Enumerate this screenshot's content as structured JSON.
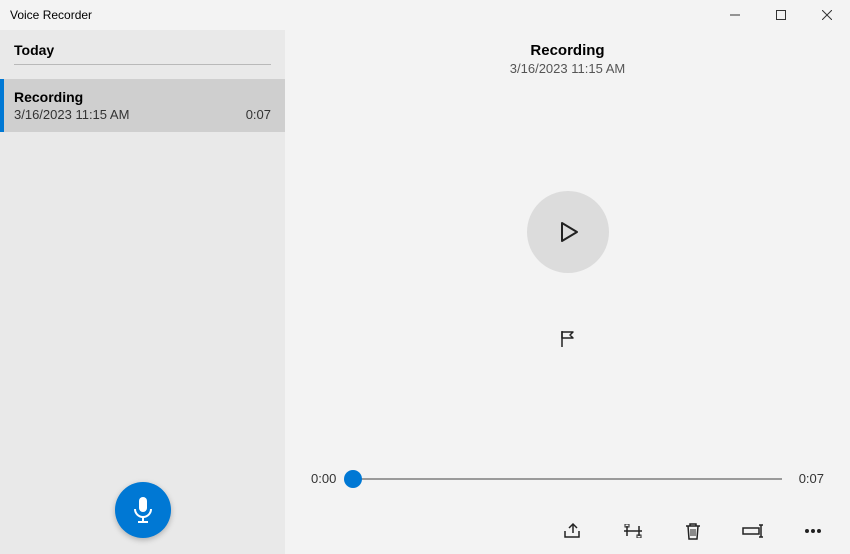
{
  "app": {
    "title": "Voice Recorder"
  },
  "sidebar": {
    "section_label": "Today",
    "items": [
      {
        "title": "Recording",
        "timestamp": "3/16/2023 11:15 AM",
        "duration": "0:07"
      }
    ]
  },
  "main": {
    "title": "Recording",
    "timestamp": "3/16/2023 11:15 AM",
    "playback": {
      "current": "0:00",
      "total": "0:07"
    }
  },
  "icons": {
    "minimize": "minimize-icon",
    "maximize": "maximize-icon",
    "close": "close-icon",
    "microphone": "microphone-icon",
    "play": "play-icon",
    "flag": "flag-icon",
    "share": "share-icon",
    "trim": "trim-icon",
    "delete": "delete-icon",
    "rename": "rename-icon",
    "more": "more-icon"
  }
}
